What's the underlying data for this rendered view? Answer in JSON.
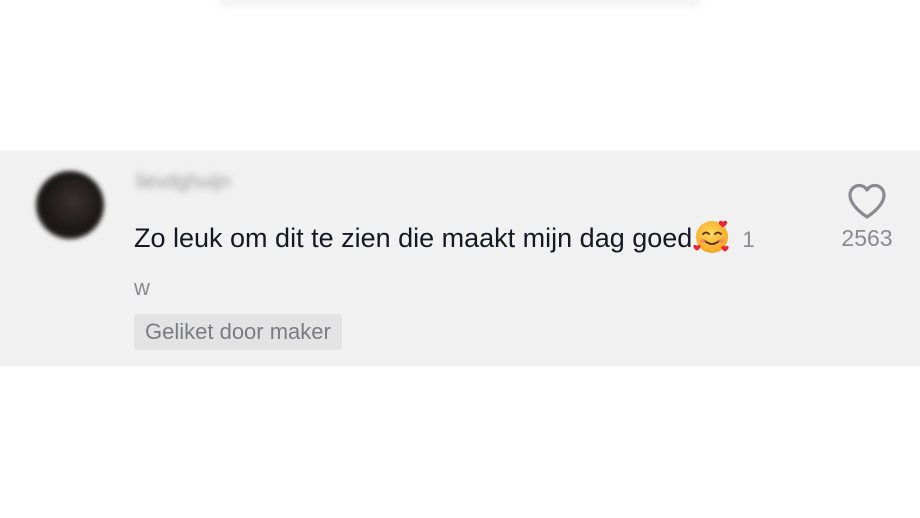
{
  "comment": {
    "username": "lievdghuijn",
    "text": "Zo leuk om dit te zien die maakt mijn dag goed",
    "emoji_name": "smiling-face-with-hearts",
    "timestamp": "1 w",
    "liked_badge": "Geliket door maker",
    "like_icon": "heart-outline-icon",
    "like_count": "2563"
  },
  "colors": {
    "card_background": "#f1f1f1",
    "text_primary": "#161823",
    "text_secondary": "#8a8b91",
    "badge_background": "#e3e3e4"
  }
}
